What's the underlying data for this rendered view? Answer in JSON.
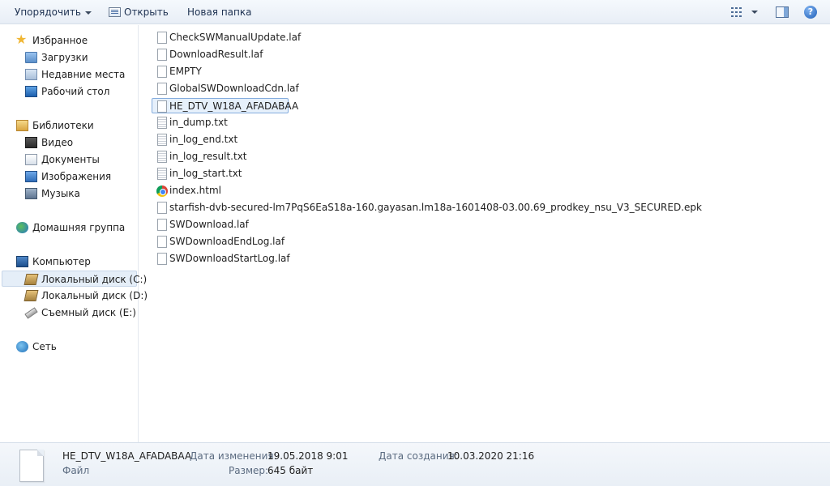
{
  "toolbar": {
    "organize_label": "Упорядочить",
    "open_label": "Открыть",
    "new_folder_label": "Новая папка",
    "help_label": "?"
  },
  "sidebar": {
    "favorites": {
      "label": "Избранное",
      "items": [
        {
          "label": "Загрузки",
          "icon": "downloads-folder-icon"
        },
        {
          "label": "Недавние места",
          "icon": "recent-places-icon"
        },
        {
          "label": "Рабочий стол",
          "icon": "desktop-icon"
        }
      ]
    },
    "libraries": {
      "label": "Библиотеки",
      "items": [
        {
          "label": "Видео",
          "icon": "video-library-icon"
        },
        {
          "label": "Документы",
          "icon": "documents-library-icon"
        },
        {
          "label": "Изображения",
          "icon": "pictures-library-icon"
        },
        {
          "label": "Музыка",
          "icon": "music-library-icon"
        }
      ]
    },
    "homegroup": {
      "label": "Домашняя группа"
    },
    "computer": {
      "label": "Компьютер",
      "items": [
        {
          "label": "Локальный диск (C:)",
          "icon": "local-disk-icon",
          "selected": true
        },
        {
          "label": "Локальный диск (D:)",
          "icon": "local-disk-icon"
        },
        {
          "label": "Съемный диск (E:)",
          "icon": "removable-disk-icon"
        }
      ]
    },
    "network": {
      "label": "Сеть"
    }
  },
  "files": [
    {
      "name": "CheckSWManualUpdate.laf",
      "type": "file"
    },
    {
      "name": "DownloadResult.laf",
      "type": "file"
    },
    {
      "name": "EMPTY",
      "type": "file"
    },
    {
      "name": "GlobalSWDownloadCdn.laf",
      "type": "file"
    },
    {
      "name": "HE_DTV_W18A_AFADABAA",
      "type": "file",
      "selected": true
    },
    {
      "name": "in_dump.txt",
      "type": "txt"
    },
    {
      "name": "in_log_end.txt",
      "type": "txt"
    },
    {
      "name": "in_log_result.txt",
      "type": "txt"
    },
    {
      "name": "in_log_start.txt",
      "type": "txt"
    },
    {
      "name": "index.html",
      "type": "chrome"
    },
    {
      "name": "starfish-dvb-secured-lm7PqS6EaS18a-160.gayasan.lm18a-1601408-03.00.69_prodkey_nsu_V3_SECURED.epk",
      "type": "file"
    },
    {
      "name": "SWDownload.laf",
      "type": "file"
    },
    {
      "name": "SWDownloadEndLog.laf",
      "type": "file"
    },
    {
      "name": "SWDownloadStartLog.laf",
      "type": "file"
    }
  ],
  "details": {
    "filename": "HE_DTV_W18A_AFADABAA",
    "filetype": "Файл",
    "modified_label": "Дата изменения:",
    "modified_value": "19.05.2018 9:01",
    "size_label": "Размер:",
    "size_value": "645 байт",
    "created_label": "Дата создания:",
    "created_value": "10.03.2020 21:16"
  }
}
